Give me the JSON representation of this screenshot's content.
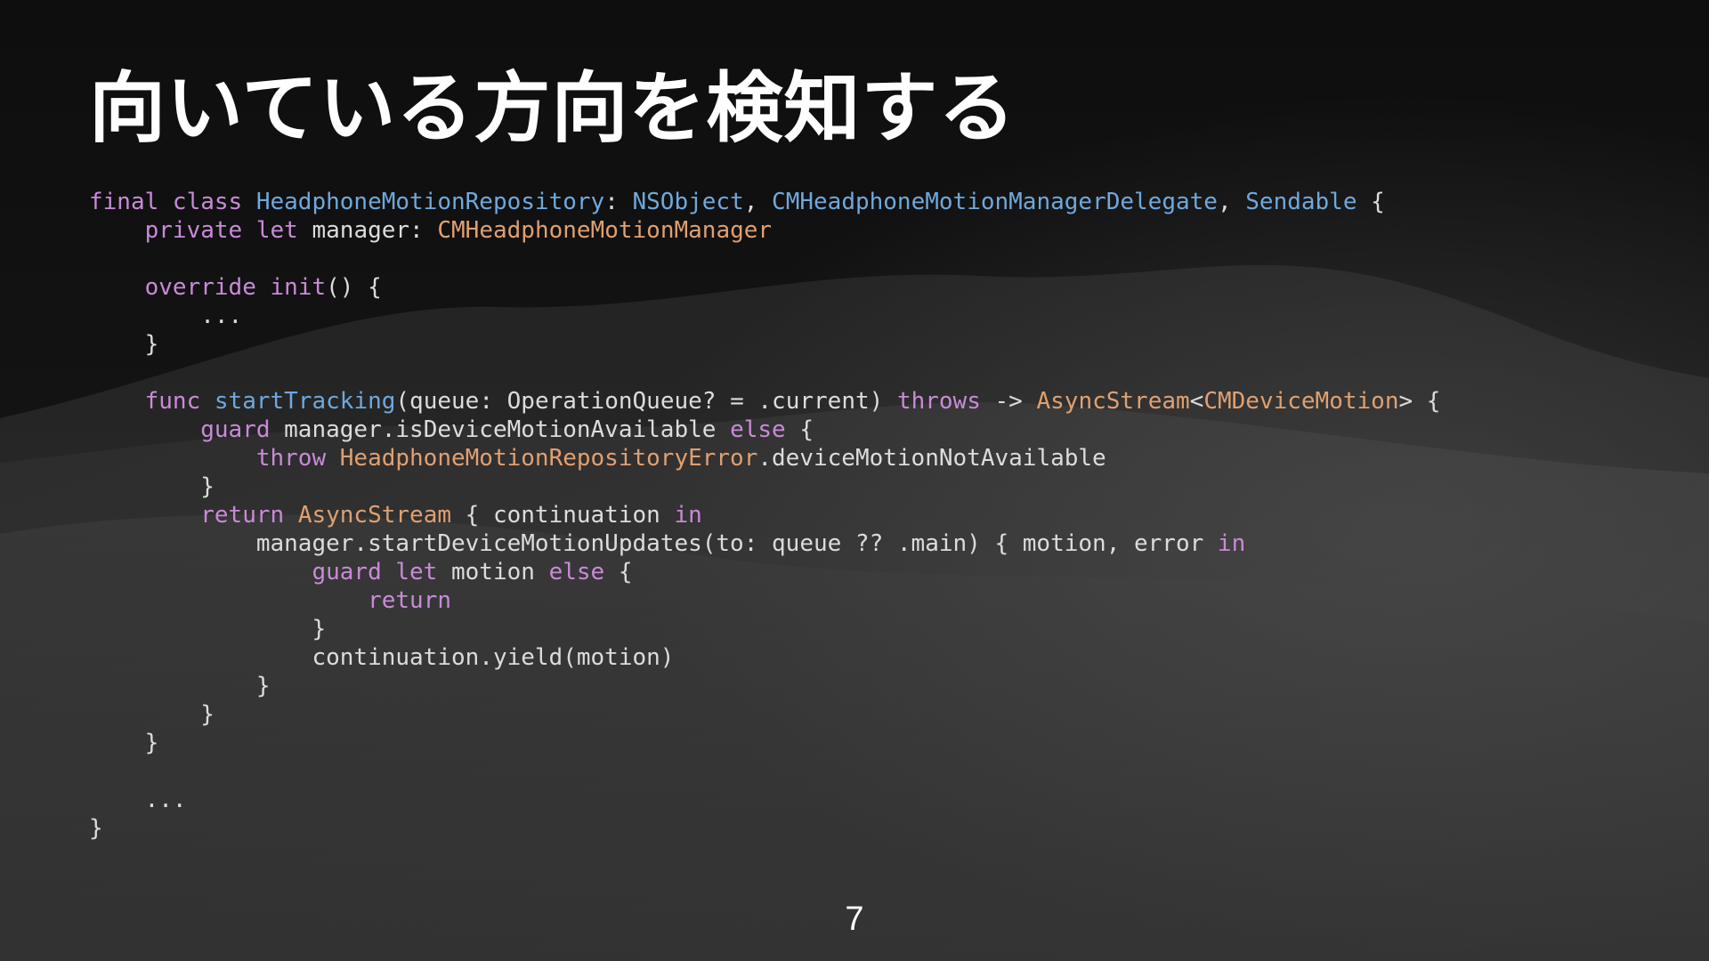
{
  "slide": {
    "title": "向いている方向を検知する",
    "page_number": "7"
  },
  "colors": {
    "background": "#141414",
    "keyword": "#c98ad8",
    "type": "#6fa8dc",
    "class": "#e0a070",
    "function": "#6fa8dc",
    "plain": "#dcdcdc"
  },
  "code": {
    "lines": [
      [
        [
          "kw",
          "final "
        ],
        [
          "kw",
          "class "
        ],
        [
          "ty",
          "HeadphoneMotionRepository"
        ],
        [
          "pl",
          ": "
        ],
        [
          "ty",
          "NSObject"
        ],
        [
          "pl",
          ", "
        ],
        [
          "ty",
          "CMHeadphoneMotionManagerDelegate"
        ],
        [
          "pl",
          ", "
        ],
        [
          "ty",
          "Sendable"
        ],
        [
          "pl",
          " {"
        ]
      ],
      [
        [
          "pl",
          "    "
        ],
        [
          "kw",
          "private "
        ],
        [
          "kw",
          "let "
        ],
        [
          "pl",
          "manager: "
        ],
        [
          "cl",
          "CMHeadphoneMotionManager"
        ]
      ],
      [],
      [
        [
          "pl",
          "    "
        ],
        [
          "kw",
          "override "
        ],
        [
          "kw",
          "init"
        ],
        [
          "pl",
          "() {"
        ]
      ],
      [
        [
          "pl",
          "        ..."
        ]
      ],
      [
        [
          "pl",
          "    }"
        ]
      ],
      [],
      [
        [
          "pl",
          "    "
        ],
        [
          "kw",
          "func "
        ],
        [
          "fn",
          "startTracking"
        ],
        [
          "pl",
          "(queue: OperationQueue? = .current) "
        ],
        [
          "kw",
          "throws"
        ],
        [
          "pl",
          " -> "
        ],
        [
          "cl",
          "AsyncStream"
        ],
        [
          "pl",
          "<"
        ],
        [
          "cl",
          "CMDeviceMotion"
        ],
        [
          "pl",
          "> {"
        ]
      ],
      [
        [
          "pl",
          "        "
        ],
        [
          "kw",
          "guard "
        ],
        [
          "pl",
          "manager.isDeviceMotionAvailable "
        ],
        [
          "kw",
          "else"
        ],
        [
          "pl",
          " {"
        ]
      ],
      [
        [
          "pl",
          "            "
        ],
        [
          "kw",
          "throw "
        ],
        [
          "cl",
          "HeadphoneMotionRepositoryError"
        ],
        [
          "pl",
          ".deviceMotionNotAvailable"
        ]
      ],
      [
        [
          "pl",
          "        }"
        ]
      ],
      [
        [
          "pl",
          "        "
        ],
        [
          "kw",
          "return "
        ],
        [
          "cl",
          "AsyncStream"
        ],
        [
          "pl",
          " { continuation "
        ],
        [
          "kw",
          "in"
        ]
      ],
      [
        [
          "pl",
          "            manager.startDeviceMotionUpdates(to: queue ?? .main) { motion, error "
        ],
        [
          "kw",
          "in"
        ]
      ],
      [
        [
          "pl",
          "                "
        ],
        [
          "kw",
          "guard "
        ],
        [
          "kw",
          "let "
        ],
        [
          "pl",
          "motion "
        ],
        [
          "kw",
          "else"
        ],
        [
          "pl",
          " {"
        ]
      ],
      [
        [
          "pl",
          "                    "
        ],
        [
          "kw",
          "return"
        ]
      ],
      [
        [
          "pl",
          "                }"
        ]
      ],
      [
        [
          "pl",
          "                continuation.yield(motion)"
        ]
      ],
      [
        [
          "pl",
          "            }"
        ]
      ],
      [
        [
          "pl",
          "        }"
        ]
      ],
      [
        [
          "pl",
          "    }"
        ]
      ],
      [],
      [
        [
          "pl",
          "    ..."
        ]
      ],
      [
        [
          "pl",
          "}"
        ]
      ]
    ]
  }
}
